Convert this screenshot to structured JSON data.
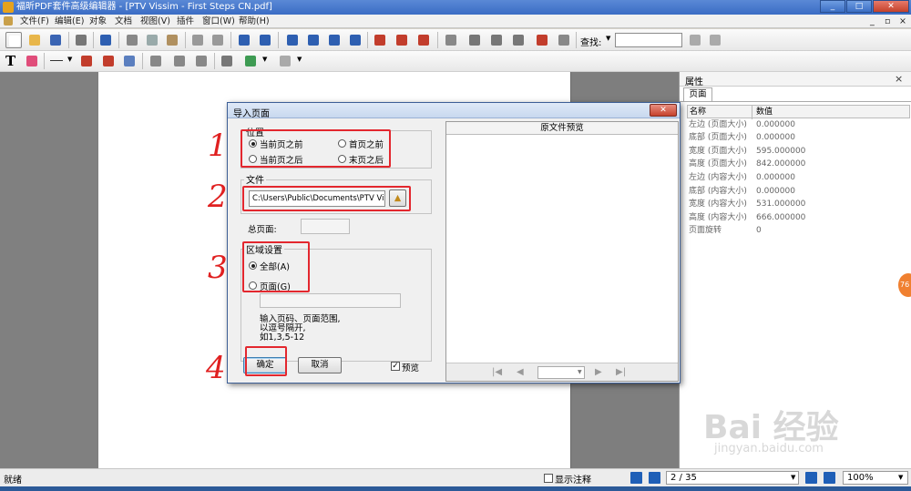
{
  "window": {
    "title": "福昕PDF套件高级编辑器 - [PTV Vissim - First Steps CN.pdf]",
    "min_btn": "_",
    "max_btn": "□",
    "close_btn": "✕"
  },
  "menu": {
    "items": [
      "文件(F)",
      "编辑(E)",
      "对象",
      "文档",
      "视图(V)",
      "插件",
      "窗口(W)",
      "帮助(H)"
    ],
    "mdi_min": "_",
    "mdi_max": "▫",
    "mdi_close": "×"
  },
  "toolbar": {
    "find_label": "查找:",
    "find_value": ""
  },
  "props_panel": {
    "title": "属性",
    "close": "×",
    "tab": "页面",
    "col_name": "名称",
    "col_value": "数值",
    "rows": [
      {
        "name": "左边 (页面大小)",
        "value": "0.000000"
      },
      {
        "name": "底部 (页面大小)",
        "value": "0.000000"
      },
      {
        "name": "宽度 (页面大小)",
        "value": "595.000000"
      },
      {
        "name": "高度 (页面大小)",
        "value": "842.000000"
      },
      {
        "name": "左边 (内容大小)",
        "value": "0.000000"
      },
      {
        "name": "底部 (内容大小)",
        "value": "0.000000"
      },
      {
        "name": "宽度 (内容大小)",
        "value": "531.000000"
      },
      {
        "name": "高度 (内容大小)",
        "value": "666.000000"
      },
      {
        "name": "页面旋转",
        "value": "0"
      }
    ]
  },
  "dialog": {
    "title": "导入页面",
    "close": "✕",
    "position_label": "位置",
    "radio_before_current": "当前页之前",
    "radio_after_current": "当前页之后",
    "radio_before_first": "首页之前",
    "radio_after_last": "末页之后",
    "file_label": "文件",
    "file_path": "C:\\Users\\Public\\Documents\\PTV Vision\\P",
    "total_pages_label": "总页面:",
    "total_pages_value": "",
    "range_label": "区域设置",
    "radio_all": "全部(A)",
    "radio_pages": "页面(G)",
    "pages_value": "",
    "hint_lines": [
      "输入页码、页面范围,",
      "以逗号隔开,",
      "如1,3,5-12"
    ],
    "ok": "确定",
    "cancel": "取消",
    "preview_checkbox": "预览",
    "preview_title": "原文件预览",
    "annotation_numbers": [
      "1",
      "2",
      "3",
      "4"
    ]
  },
  "statusbar": {
    "status": "就绪",
    "show_annotations": "显示注释",
    "page": "2 / 35",
    "zoom": "100%"
  },
  "watermark": {
    "logo": "Bai 经验",
    "url": "jingyan.baidu.com"
  },
  "badge": "76"
}
